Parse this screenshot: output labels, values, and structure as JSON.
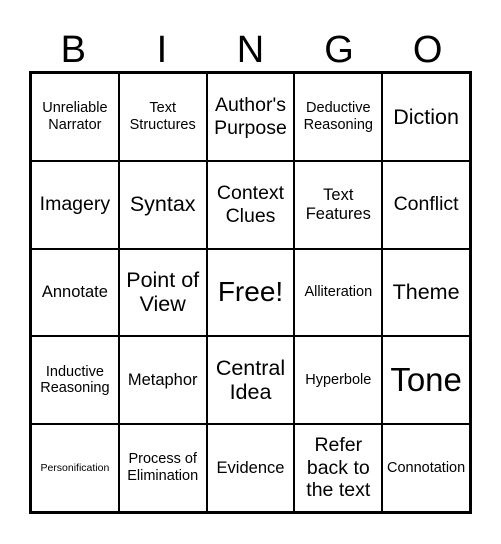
{
  "header": {
    "letters": [
      "B",
      "I",
      "N",
      "G",
      "O"
    ]
  },
  "cells": [
    [
      "Unreliable Narrator",
      "Text Structures",
      "Author's Purpose",
      "Deductive Reasoning",
      "Diction"
    ],
    [
      "Imagery",
      "Syntax",
      "Context Clues",
      "Text Features",
      "Conflict"
    ],
    [
      "Annotate",
      "Point of View",
      "Free!",
      "Alliteration",
      "Theme"
    ],
    [
      "Inductive Reasoning",
      "Metaphor",
      "Central Idea",
      "Hyperbole",
      "Tone"
    ],
    [
      "Personification",
      "Process of Elimination",
      "Evidence",
      "Refer back to the text",
      "Connotation"
    ]
  ]
}
